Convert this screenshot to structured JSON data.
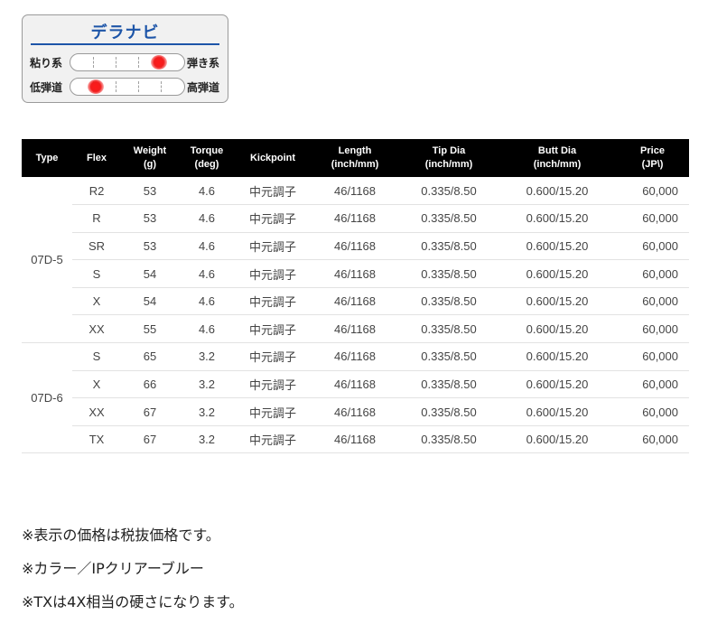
{
  "navi": {
    "title": "デラナビ",
    "rows": [
      {
        "left_label": "粘り系",
        "right_label": "弾き系",
        "position": 0.82
      },
      {
        "left_label": "低弾道",
        "right_label": "高弾道",
        "position": 0.18
      }
    ],
    "dot_color": "#f21d1d",
    "accent_color": "#1d55a8"
  },
  "table": {
    "headers": [
      [
        "Type"
      ],
      [
        "Flex"
      ],
      [
        "Weight",
        "(g)"
      ],
      [
        "Torque",
        "(deg)"
      ],
      [
        "Kickpoint"
      ],
      [
        "Length",
        "(inch/mm)"
      ],
      [
        "Tip Dia",
        "(inch/mm)"
      ],
      [
        "Butt Dia",
        "(inch/mm)"
      ],
      [
        "Price",
        "(JP\\)"
      ]
    ],
    "groups": [
      {
        "type": "07D-5",
        "rows": [
          [
            "R2",
            "53",
            "4.6",
            "中元調子",
            "46/1168",
            "0.335/8.50",
            "0.600/15.20",
            "60,000"
          ],
          [
            "R",
            "53",
            "4.6",
            "中元調子",
            "46/1168",
            "0.335/8.50",
            "0.600/15.20",
            "60,000"
          ],
          [
            "SR",
            "53",
            "4.6",
            "中元調子",
            "46/1168",
            "0.335/8.50",
            "0.600/15.20",
            "60,000"
          ],
          [
            "S",
            "54",
            "4.6",
            "中元調子",
            "46/1168",
            "0.335/8.50",
            "0.600/15.20",
            "60,000"
          ],
          [
            "X",
            "54",
            "4.6",
            "中元調子",
            "46/1168",
            "0.335/8.50",
            "0.600/15.20",
            "60,000"
          ],
          [
            "XX",
            "55",
            "4.6",
            "中元調子",
            "46/1168",
            "0.335/8.50",
            "0.600/15.20",
            "60,000"
          ]
        ]
      },
      {
        "type": "07D-6",
        "rows": [
          [
            "S",
            "65",
            "3.2",
            "中元調子",
            "46/1168",
            "0.335/8.50",
            "0.600/15.20",
            "60,000"
          ],
          [
            "X",
            "66",
            "3.2",
            "中元調子",
            "46/1168",
            "0.335/8.50",
            "0.600/15.20",
            "60,000"
          ],
          [
            "XX",
            "67",
            "3.2",
            "中元調子",
            "46/1168",
            "0.335/8.50",
            "0.600/15.20",
            "60,000"
          ],
          [
            "TX",
            "67",
            "3.2",
            "中元調子",
            "46/1168",
            "0.335/8.50",
            "0.600/15.20",
            "60,000"
          ]
        ]
      }
    ]
  },
  "notes": [
    "※表示の価格は税抜価格です。",
    "※カラー／IPクリアーブルー",
    "※TXは4X相当の硬さになります。"
  ]
}
